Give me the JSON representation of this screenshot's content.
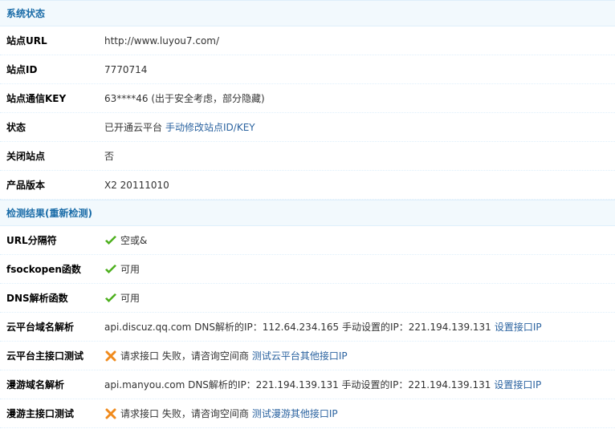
{
  "system_status": {
    "header": "系统状态",
    "rows": [
      {
        "label": "站点URL",
        "value": "http://www.luyou7.com/"
      },
      {
        "label": "站点ID",
        "value": "7770714"
      },
      {
        "label": "站点通信KEY",
        "value": "63****46 (出于安全考虑，部分隐藏)"
      },
      {
        "label": "状态",
        "value": "已开通云平台",
        "link": "手动修改站点ID/KEY"
      },
      {
        "label": "关闭站点",
        "value": "否"
      },
      {
        "label": "产品版本",
        "value": "X2 20111010"
      }
    ]
  },
  "check_results": {
    "header": "检测结果",
    "recheck": "(重新检测)",
    "rows": [
      {
        "label": "URL分隔符",
        "icon": "check-icon",
        "value": "空或&"
      },
      {
        "label": "fsockopen函数",
        "icon": "check-icon",
        "value": "可用"
      },
      {
        "label": "DNS解析函数",
        "icon": "check-icon",
        "value": "可用"
      },
      {
        "label": "云平台域名解析",
        "value": "api.discuz.qq.com DNS解析的IP：112.64.234.165 手动设置的IP：221.194.139.131",
        "link": "设置接口IP"
      },
      {
        "label": "云平台主接口测试",
        "icon": "cross-icon",
        "value": "请求接口 失败，请咨询空间商",
        "link": "测试云平台其他接口IP"
      },
      {
        "label": "漫游域名解析",
        "value": "api.manyou.com DNS解析的IP：221.194.139.131 手动设置的IP：221.194.139.131",
        "link": "设置接口IP"
      },
      {
        "label": "漫游主接口测试",
        "icon": "cross-icon",
        "value": "请求接口 失败，请咨询空间商",
        "link": "测试漫游其他接口IP"
      }
    ]
  },
  "colors": {
    "header_bg": "#f2f9fd",
    "header_text": "#1a6ca8",
    "link": "#2b63a0",
    "check": "#4caf1c",
    "cross": "#f08a1c"
  }
}
